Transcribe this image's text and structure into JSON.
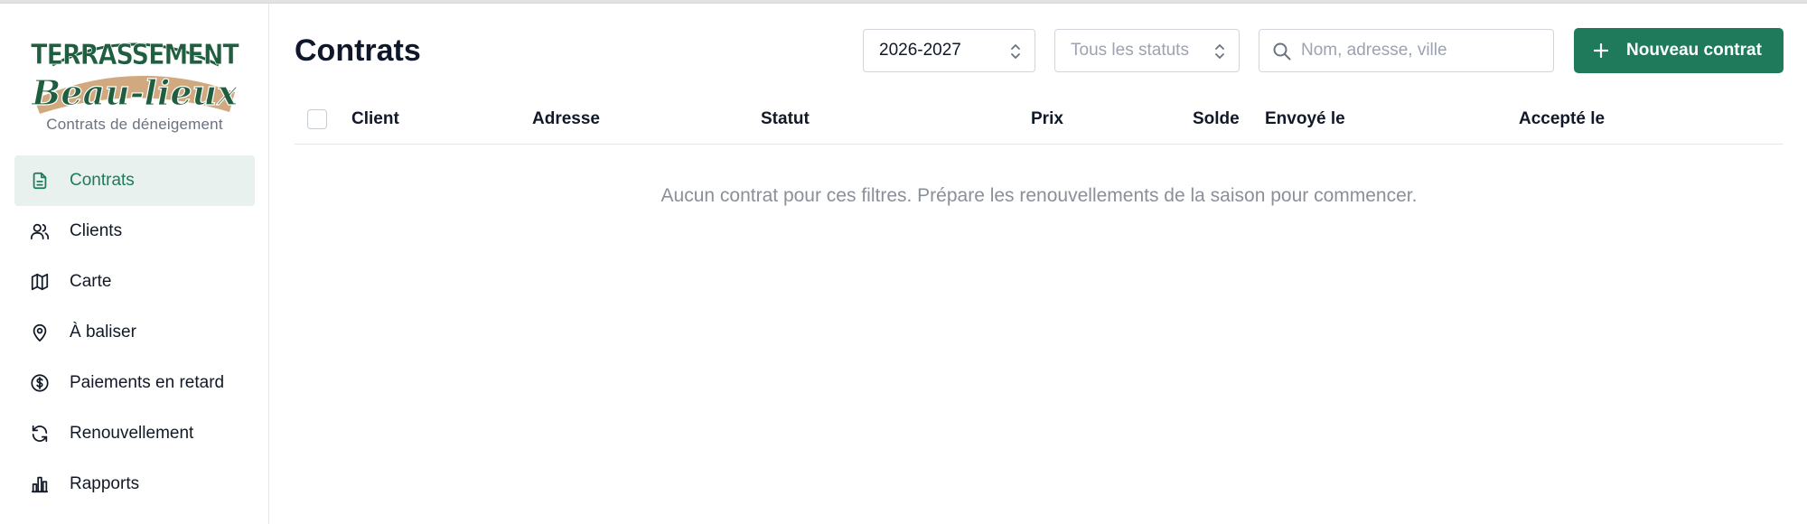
{
  "brand": {
    "logo_text": "Terrassement Beau-lieux",
    "subtitle": "Contrats de déneigement",
    "colors": {
      "green": "#1f5f3f",
      "tan": "#c99a6a"
    }
  },
  "sidebar": {
    "items": [
      {
        "label": "Contrats",
        "icon": "document-icon",
        "active": true
      },
      {
        "label": "Clients",
        "icon": "users-icon",
        "active": false
      },
      {
        "label": "Carte",
        "icon": "map-icon",
        "active": false
      },
      {
        "label": "À baliser",
        "icon": "map-pin-icon",
        "active": false
      },
      {
        "label": "Paiements en retard",
        "icon": "dollar-circle-icon",
        "active": false
      },
      {
        "label": "Renouvellement",
        "icon": "refresh-icon",
        "active": false
      },
      {
        "label": "Rapports",
        "icon": "bar-chart-icon",
        "active": false
      }
    ],
    "active_color": "#1f7a5c",
    "active_bg": "#e9f1ee"
  },
  "header": {
    "title": "Contrats",
    "season_select": {
      "value": "2026-2027"
    },
    "status_select": {
      "placeholder": "Tous les statuts"
    },
    "search": {
      "placeholder": "Nom, adresse, ville",
      "value": ""
    },
    "new_button": {
      "label": "Nouveau contrat",
      "color": "#1f7a5c"
    }
  },
  "table": {
    "columns": [
      "Client",
      "Adresse",
      "Statut",
      "Prix",
      "Solde",
      "Envoyé le",
      "Accepté le"
    ],
    "rows": [],
    "empty_message": "Aucun contrat pour ces filtres. Prépare les renouvellements de la saison pour commencer."
  }
}
